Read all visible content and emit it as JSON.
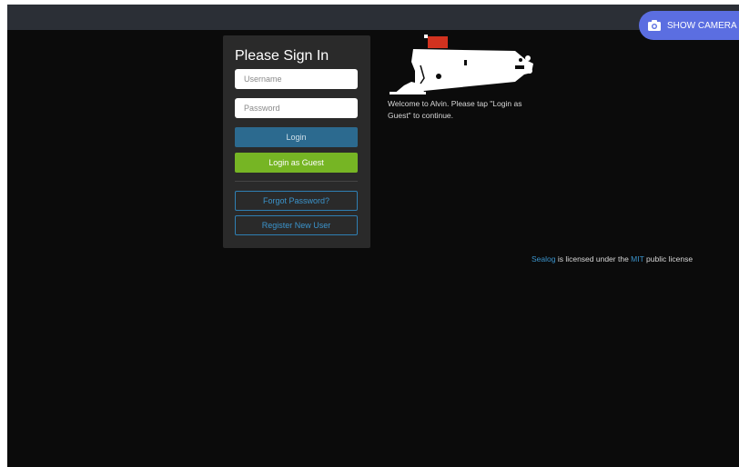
{
  "header": {
    "camera_button_label": "SHOW CAMERA"
  },
  "login": {
    "title": "Please Sign In",
    "username_placeholder": "Username",
    "password_placeholder": "Password",
    "login_label": "Login",
    "guest_label": "Login as Guest",
    "forgot_label": "Forgot Password?",
    "register_label": "Register New User"
  },
  "welcome": {
    "text": "Welcome to Alvin. Please tap \"Login as Guest\" to continue."
  },
  "footer": {
    "project_link": "Sealog",
    "license_middle": " is licensed under the ",
    "license_link": "MIT",
    "license_end": " public license"
  },
  "colors": {
    "background": "#0b0b0b",
    "topbar": "#2b2f36",
    "panel": "#2a2a2a",
    "camera_button": "#5b6ee1",
    "login_button": "#2c6a8f",
    "guest_button": "#76b524",
    "link": "#3b94cc",
    "sub_accent": "#d2321f"
  },
  "icons": {
    "camera": "camera-icon",
    "logo": "alvin-submarine-logo"
  }
}
